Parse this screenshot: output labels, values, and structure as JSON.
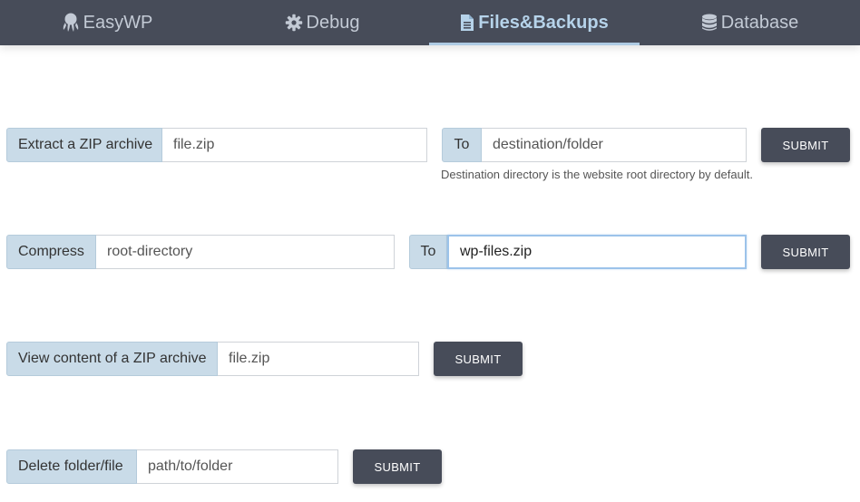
{
  "nav": {
    "tabs": [
      {
        "label": "EasyWP",
        "icon": "octopus-icon",
        "active": false
      },
      {
        "label": "Debug",
        "icon": "gear-icon",
        "active": false
      },
      {
        "label": "Files&Backups",
        "icon": "file-icon",
        "active": true
      },
      {
        "label": "Database",
        "icon": "database-icon",
        "active": false
      }
    ]
  },
  "extract": {
    "label": "Extract a ZIP archive",
    "source_placeholder": "file.zip",
    "to_label": "To",
    "dest_placeholder": "destination/folder",
    "hint": "Destination directory is the website root directory by default.",
    "submit_label": "SUBMIT"
  },
  "compress": {
    "label": "Compress",
    "source_placeholder": "root-directory",
    "to_label": "To",
    "dest_value": "wp-files.zip",
    "submit_label": "SUBMIT"
  },
  "view": {
    "label": "View content of a ZIP archive",
    "source_placeholder": "file.zip",
    "submit_label": "SUBMIT"
  },
  "delete": {
    "label": "Delete folder/file",
    "path_placeholder": "path/to/folder",
    "submit_label": "SUBMIT"
  },
  "colors": {
    "navbar": "#474c59",
    "active_tab": "#b6d3ea",
    "addon": "#c9dbe8",
    "button": "#474c59"
  }
}
